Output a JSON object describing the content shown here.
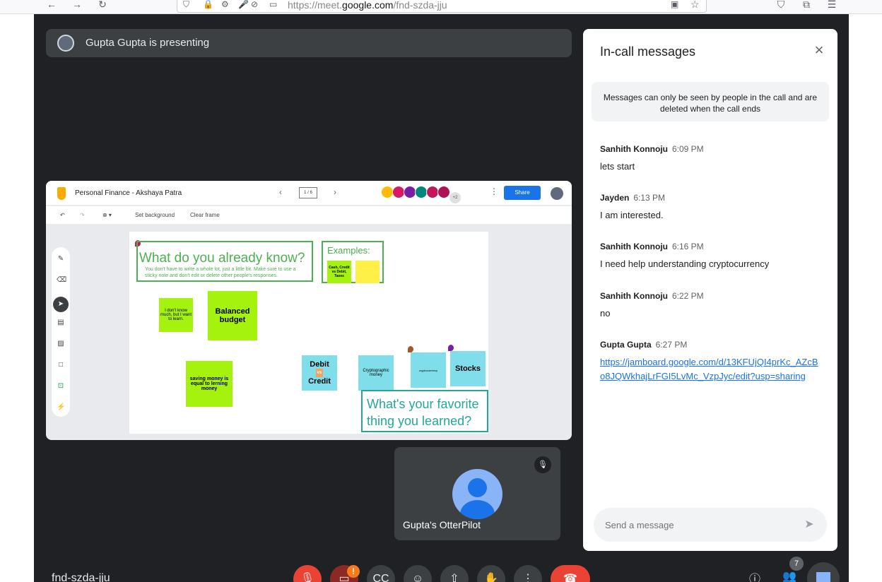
{
  "browser": {
    "url_prefix": "https://meet.",
    "url_domain": "google.com",
    "url_path": "/fnd-szda-jju"
  },
  "presenting": {
    "text": "Gupta Gupta is presenting"
  },
  "jamboard": {
    "title": "Personal Finance - Akshaya Patra",
    "frame_counter": "1 / 6",
    "share_label": "Share",
    "avatar_more": "+2",
    "tool_set_background": "Set background",
    "tool_clear_frame": "Clear frame",
    "question1": "What do you already know?",
    "question1_sub": "You don't have to write a whole lot, just a little bit. Make sure to use a sticky note and don't edit or delete other people's responses.",
    "examples_title": "Examples:",
    "ex_sticky": "Cash, Credit vs Debit, Taxes",
    "sticky_dont_know": "I don't know much, but I want to learn.",
    "sticky_balanced": "Balanced budget",
    "sticky_saving": "saving money is equal to lerning money",
    "sticky_debit_top": "Debit",
    "sticky_debit_vs": "vs",
    "sticky_debit_bottom": "Credit",
    "sticky_crypto_money": "Cryptographic money",
    "sticky_cryptocurrency": "cryptocurrency",
    "sticky_stocks": "Stocks",
    "question2": "What's your favorite thing you learned?"
  },
  "tile": {
    "name": "Gupta's OtterPilot"
  },
  "meeting_code": "fnd-szda-jju",
  "participants_count": "7",
  "panel": {
    "title": "In-call messages",
    "notice": "Messages can only be seen by people in the call and are deleted when the call ends",
    "messages": [
      {
        "sender": "Sanhith Konnoju",
        "time": "6:09 PM",
        "text": "lets start"
      },
      {
        "sender": "Jayden",
        "time": "6:13 PM",
        "text": "I am interested."
      },
      {
        "sender": "Sanhith Konnoju",
        "time": "6:16 PM",
        "text": "I need help understanding cryptocurrency"
      },
      {
        "sender": "Sanhith Konnoju",
        "time": "6:22 PM",
        "text": "no"
      },
      {
        "sender": "Gupta Gupta",
        "time": "6:27 PM",
        "text": "https://jamboard.google.com/d/13KFUjQI4prKc_AZcBo8JQWkhajLrFGI5LvMc_VzpJyc/edit?usp=sharing"
      }
    ],
    "input_placeholder": "Send a message"
  }
}
